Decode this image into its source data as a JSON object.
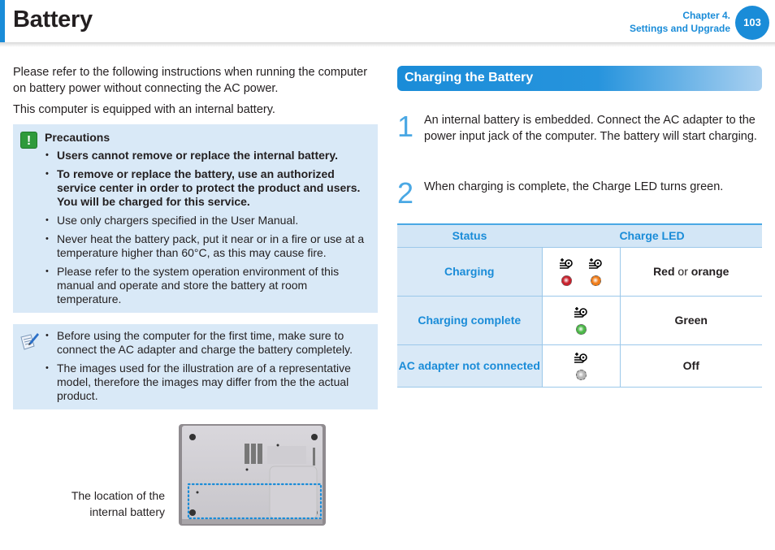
{
  "header": {
    "title": "Battery",
    "chapter_line1": "Chapter 4.",
    "chapter_line2": "Settings and Upgrade",
    "page_number": "103"
  },
  "intro": {
    "paragraph1": "Please refer to the following instructions when running the computer on battery power without connecting the AC power.",
    "paragraph2": "This computer is equipped with an internal battery."
  },
  "precautions": {
    "icon": "exclamation-icon",
    "title": "Precautions",
    "items": [
      {
        "text": "Users cannot remove or replace the internal battery.",
        "bold": true
      },
      {
        "text": "To remove or replace the battery, use an authorized service center in order to protect the product and users. You will be charged for this service.",
        "bold": true
      },
      {
        "text": "Use only chargers specified in the User Manual.",
        "bold": false
      },
      {
        "text": "Never heat the battery pack, put it near or in a fire or use at a temperature higher than 60°C, as this may cause fire.",
        "bold": false
      },
      {
        "text": "Please refer to the system operation environment of this manual and operate and store the battery at room temperature.",
        "bold": false
      }
    ]
  },
  "note": {
    "icon": "note-pencil-icon",
    "items": [
      "Before using the computer for the first time, make sure to connect the AC adapter and charge the battery completely.",
      "The images used for the illustration are of a representative model, therefore the images may differ from the the actual product."
    ]
  },
  "figure": {
    "caption_line1": "The location of the",
    "caption_line2": "internal battery"
  },
  "section": {
    "title": "Charging the Battery",
    "steps": [
      {
        "number": "1",
        "text": "An internal battery is embedded. Connect the AC adapter to the power input jack of the computer. The battery will start charging."
      },
      {
        "number": "2",
        "text": "When charging is complete, the Charge LED turns green."
      }
    ]
  },
  "led_table": {
    "headers": [
      "Status",
      "Charge LED"
    ],
    "rows": [
      {
        "status": "Charging",
        "leds": [
          "#c8202c",
          "#f07d1a"
        ],
        "color_a": "Red",
        "joiner": " or ",
        "color_b": "orange"
      },
      {
        "status": "Charging complete",
        "leds": [
          "#4cb848"
        ],
        "color_a": "Green",
        "joiner": "",
        "color_b": ""
      },
      {
        "status": "AC adapter not connected",
        "leds": [
          "#b5b5b5"
        ],
        "color_a": "Off",
        "joiner": "",
        "color_b": ""
      }
    ]
  },
  "colors": {
    "accent": "#1a8cd8",
    "box_bg": "#d9e9f7"
  }
}
